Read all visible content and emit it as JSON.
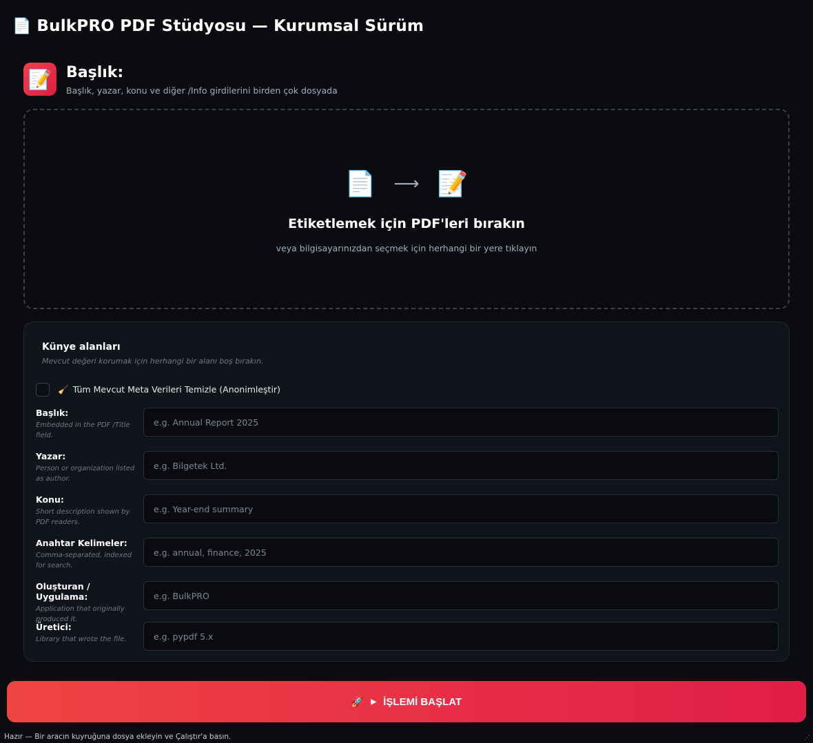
{
  "app": {
    "icon": "document-icon",
    "title": "BulkPRO PDF Stüdyosu — Kurumsal Sürüm"
  },
  "tool": {
    "icon": "memo-pencil-icon",
    "title": "Başlık:",
    "subtitle": "Başlık, yazar, konu ve diğer /Info girdilerini birden çok dosyada"
  },
  "dropzone": {
    "icons": [
      "document-icon",
      "arrow-right-icon",
      "memo-pencil-icon"
    ],
    "title": "Etiketlemek için PDF'leri bırakın",
    "subtitle": "veya bilgisayarınızdan seçmek için herhangi bir yere tıklayın"
  },
  "panel": {
    "title": "Künye alanları",
    "hint": "Mevcut değeri korumak için herhangi bir alanı boş bırakın.",
    "anonymize": {
      "icon": "broom-icon",
      "label": "Tüm Mevcut Meta Verileri Temizle (Anonimleştir)",
      "checked": false
    },
    "fields": [
      {
        "label": "Başlık:",
        "description": "Embedded in the PDF /Title field.",
        "placeholder": "e.g. Annual Report 2025",
        "value": ""
      },
      {
        "label": "Yazar:",
        "description": "Person or organization listed as author.",
        "placeholder": "e.g. Bilgetek Ltd.",
        "value": ""
      },
      {
        "label": "Konu:",
        "description": "Short description shown by PDF readers.",
        "placeholder": "e.g. Year-end summary",
        "value": ""
      },
      {
        "label": "Anahtar Kelimeler:",
        "description": "Comma-separated, indexed for search.",
        "placeholder": "e.g. annual, finance, 2025",
        "value": ""
      },
      {
        "label": "Oluşturan / Uygulama:",
        "description": "Application that originally produced it.",
        "placeholder": "e.g. BulkPRO",
        "value": ""
      },
      {
        "label": "Üretici:",
        "description": "Library that wrote the file.",
        "placeholder": "e.g. pypdf 5.x",
        "value": ""
      }
    ]
  },
  "run_button": {
    "icon": "rocket-icon",
    "label": "İŞLEMİ BAŞLAT"
  },
  "status": {
    "text": "Hazır — Bir aracın kuyruğuna dosya ekleyin ve Çalıştır'a basın."
  },
  "colors": {
    "background": "#0b0c10",
    "panel": "#12141b",
    "accent_start": "#ef4444",
    "accent_end": "#e11d48"
  }
}
